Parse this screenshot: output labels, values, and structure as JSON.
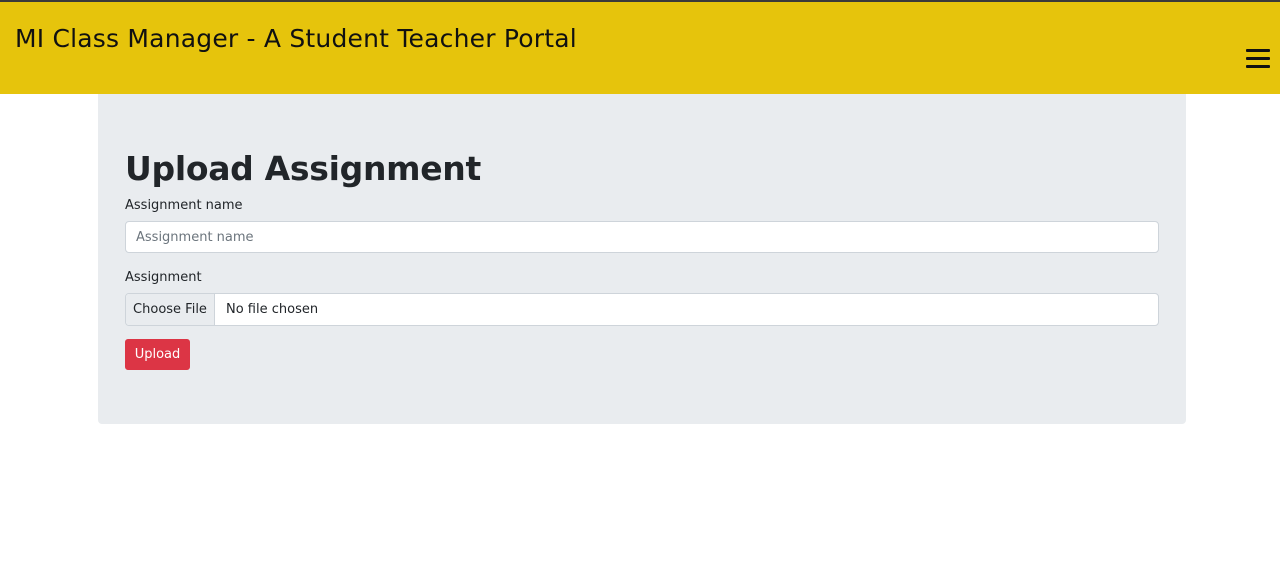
{
  "header": {
    "title": "MI Class Manager - A Student Teacher Portal",
    "menu_icon": "hamburger-menu-icon",
    "background_color": "#e6c40c"
  },
  "form": {
    "title": "Upload Assignment",
    "assignment_name": {
      "label": "Assignment name",
      "placeholder": "Assignment name",
      "value": ""
    },
    "assignment_file": {
      "label": "Assignment",
      "choose_label": "Choose File",
      "status": "No file chosen"
    },
    "submit_label": "Upload",
    "submit_color": "#dc3545"
  }
}
